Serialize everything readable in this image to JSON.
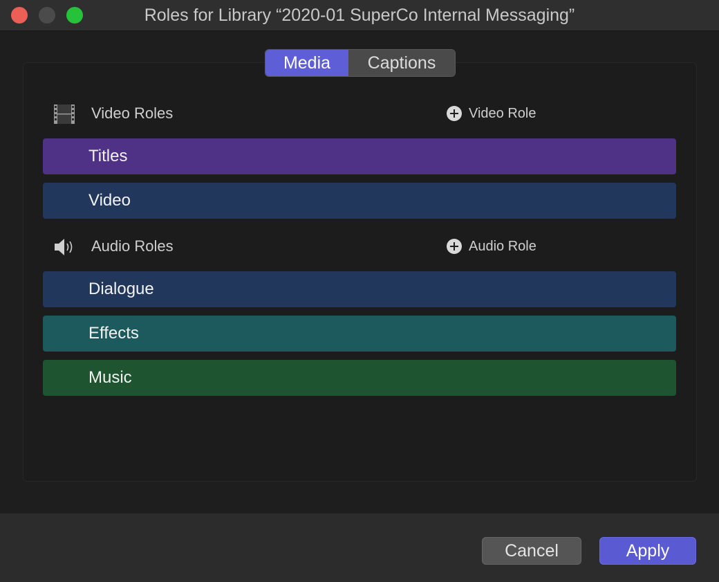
{
  "window": {
    "title": "Roles for Library “2020-01 SuperCo Internal Messaging”"
  },
  "tabs": [
    {
      "label": "Media",
      "selected": true
    },
    {
      "label": "Captions",
      "selected": false
    }
  ],
  "video_section": {
    "icon": "film-strip-icon",
    "label": "Video Roles",
    "add_label": "Video Role",
    "roles": [
      {
        "label": "Titles",
        "color": "#4f3186"
      },
      {
        "label": "Video",
        "color": "#22375c"
      }
    ]
  },
  "audio_section": {
    "icon": "speaker-icon",
    "label": "Audio Roles",
    "add_label": "Audio Role",
    "roles": [
      {
        "label": "Dialogue",
        "color": "#22375c"
      },
      {
        "label": "Effects",
        "color": "#1d5a5d"
      },
      {
        "label": "Music",
        "color": "#1e5530"
      }
    ]
  },
  "buttons": {
    "cancel": "Cancel",
    "apply": "Apply"
  },
  "colors": {
    "accent": "#5e5ed6"
  }
}
